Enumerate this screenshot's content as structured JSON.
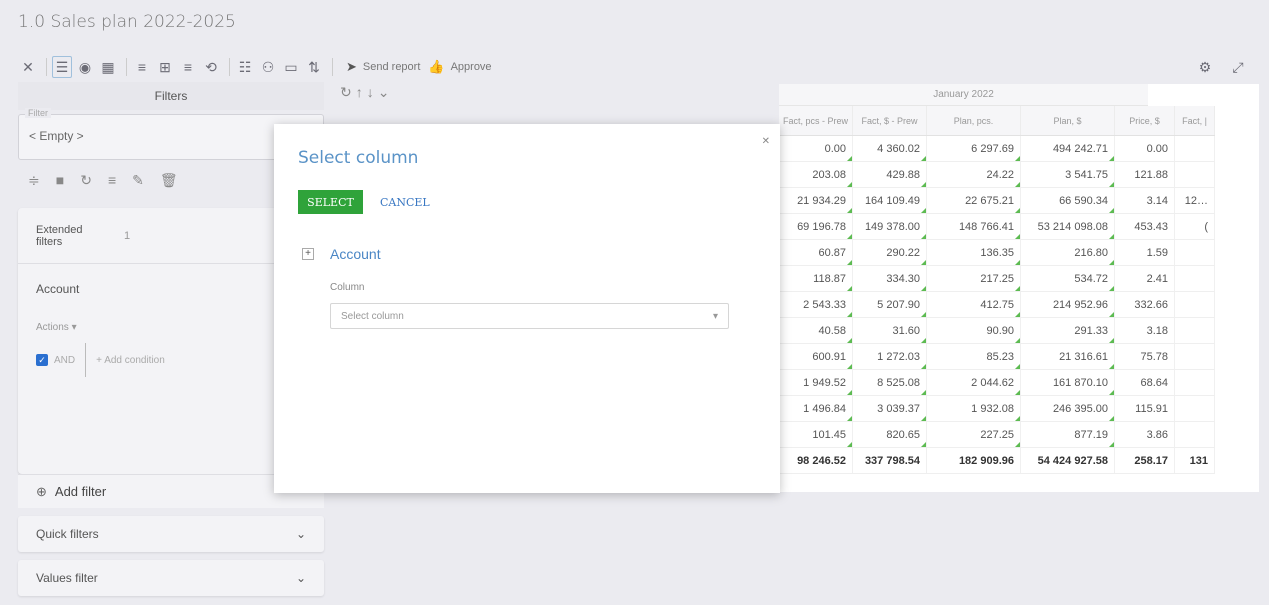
{
  "page": {
    "title": "1.0 Sales plan 2022-2025"
  },
  "toolbar": {
    "send_report": "Send report",
    "approve": "Approve"
  },
  "filters": {
    "header": "Filters",
    "legend": "Filter",
    "value": "< Empty >",
    "extended_label": "Extended filters",
    "extended_count": "1",
    "account": "Account",
    "actions": "Actions ▾",
    "and": "AND",
    "add_condition": "+ Add condition",
    "add_filter": "Add filter",
    "quick_filters": "Quick filters",
    "values_filter": "Values filter"
  },
  "grid": {
    "month": "January 2022",
    "columns": [
      "Fact, pcs - Prew",
      "Fact, $ - Prew",
      "Plan, pcs.",
      "Plan, $",
      "Price, $",
      "Fact, |"
    ],
    "rows": [
      [
        "0.00",
        "4 360.02",
        "6 297.69",
        "494 242.71",
        "0.00",
        ""
      ],
      [
        "203.08",
        "429.88",
        "24.22",
        "3 541.75",
        "121.88",
        ""
      ],
      [
        "21 934.29",
        "164 109.49",
        "22 675.21",
        "66 590.34",
        "3.14",
        "12…"
      ],
      [
        "69 196.78",
        "149 378.00",
        "148 766.41",
        "53 214 098.08",
        "453.43",
        "("
      ],
      [
        "60.87",
        "290.22",
        "136.35",
        "216.80",
        "1.59",
        ""
      ],
      [
        "118.87",
        "334.30",
        "217.25",
        "534.72",
        "2.41",
        ""
      ],
      [
        "2 543.33",
        "5 207.90",
        "412.75",
        "214 952.96",
        "332.66",
        ""
      ],
      [
        "40.58",
        "31.60",
        "90.90",
        "291.33",
        "3.18",
        ""
      ],
      [
        "600.91",
        "1 272.03",
        "85.23",
        "21 316.61",
        "75.78",
        ""
      ],
      [
        "1 949.52",
        "8 525.08",
        "2 044.62",
        "161 870.10",
        "68.64",
        ""
      ],
      [
        "1 496.84",
        "3 039.37",
        "1 932.08",
        "246 395.00",
        "115.91",
        ""
      ],
      [
        "101.45",
        "820.65",
        "227.25",
        "877.19",
        "3.86",
        ""
      ]
    ],
    "total": [
      "98 246.52",
      "337 798.54",
      "182 909.96",
      "54 424 927.58",
      "258.17",
      "131"
    ]
  },
  "modal": {
    "title": "Select column",
    "select_btn": "SELECT",
    "cancel_btn": "CANCEL",
    "group": "Account",
    "column_label": "Column",
    "column_placeholder": "Select column"
  }
}
